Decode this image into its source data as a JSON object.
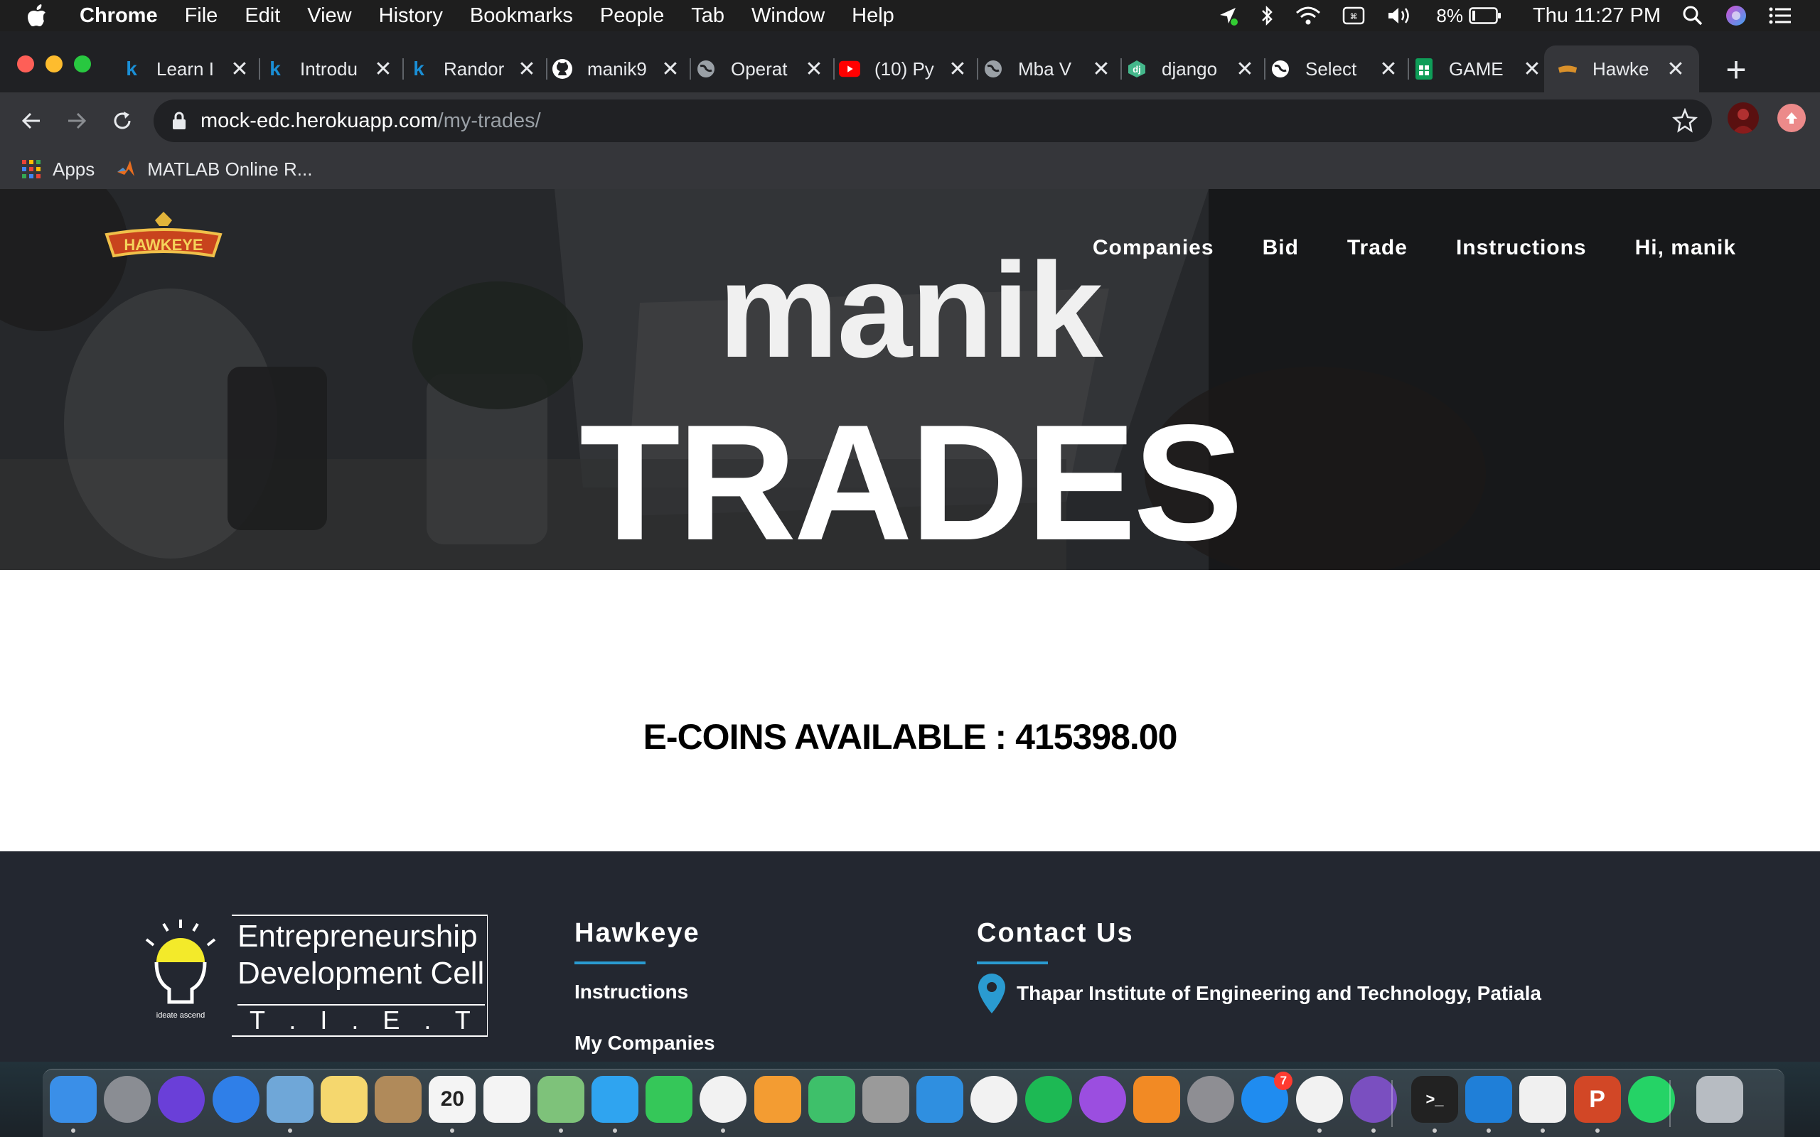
{
  "menubar": {
    "app_name": "Chrome",
    "items": [
      "File",
      "Edit",
      "View",
      "History",
      "Bookmarks",
      "People",
      "Tab",
      "Window",
      "Help"
    ],
    "battery": "8%",
    "clock": "Thu 11:27 PM"
  },
  "tabs": [
    {
      "label": "Learn I",
      "icon": "k-icon",
      "color": "#1a8fd6"
    },
    {
      "label": "Introdu",
      "icon": "k-icon",
      "color": "#1a8fd6"
    },
    {
      "label": "Randor",
      "icon": "k-icon",
      "color": "#1a8fd6"
    },
    {
      "label": "manik9",
      "icon": "github-icon",
      "color": "#ffffff"
    },
    {
      "label": "Operat",
      "icon": "globe-icon",
      "color": "#9aa0a6"
    },
    {
      "label": "(10) Py",
      "icon": "youtube-icon",
      "color": "#ff0000"
    },
    {
      "label": "Mba V",
      "icon": "globe-icon",
      "color": "#9aa0a6"
    },
    {
      "label": "django",
      "icon": "django-icon",
      "color": "#44b78b"
    },
    {
      "label": "Select",
      "icon": "globe-icon",
      "color": "#ffffff"
    },
    {
      "label": "GAME",
      "icon": "sheets-icon",
      "color": "#0f9d58"
    },
    {
      "label": "Hawke",
      "icon": "hawkeye-icon",
      "color": "#d9902a",
      "active": true
    }
  ],
  "address": {
    "host": "mock-edc.herokuapp.com",
    "path": "/my-trades/"
  },
  "bookmarks": [
    {
      "label": "Apps",
      "icon": "apps-grid-icon"
    },
    {
      "label": "MATLAB Online R...",
      "icon": "matlab-icon"
    }
  ],
  "site": {
    "logo_text": "HAWKEYE",
    "nav": [
      "Companies",
      "Bid",
      "Trade",
      "Instructions",
      "Hi, manik"
    ],
    "hero_name": "manik",
    "hero_title": "TRADES",
    "coins_label": "E-COINS AVAILABLE : 415398.00"
  },
  "footer": {
    "edc_line1": "Entrepreneurship",
    "edc_line2": "Development Cell",
    "edc_line3": "T . I . E . T .",
    "edc_bulb_text": "ideate ascend",
    "col1_title": "Hawkeye",
    "col1_links": [
      "Instructions",
      "My Companies"
    ],
    "col2_title": "Contact Us",
    "address": "Thapar Institute of Engineering and Technology, Patiala"
  },
  "dock": [
    {
      "name": "finder-icon",
      "color": "#3a8fe8",
      "label": ""
    },
    {
      "name": "launchpad-icon",
      "color": "#8a8d93",
      "label": ""
    },
    {
      "name": "siri-icon",
      "color": "#6a3fd8",
      "label": ""
    },
    {
      "name": "safari-icon",
      "color": "#2f7fe8",
      "label": ""
    },
    {
      "name": "mail-hawk-icon",
      "color": "#6fa7d8",
      "label": ""
    },
    {
      "name": "notes-icon",
      "color": "#f5d76e",
      "label": ""
    },
    {
      "name": "contacts-icon",
      "color": "#b08a5a",
      "label": ""
    },
    {
      "name": "calendar-icon",
      "color": "#f4f4f4",
      "label": "20"
    },
    {
      "name": "reminders-icon",
      "color": "#f4f4f4",
      "label": ""
    },
    {
      "name": "maps-icon",
      "color": "#7ec27a",
      "label": ""
    },
    {
      "name": "messages-icon",
      "color": "#2fa4f0",
      "label": ""
    },
    {
      "name": "facetime-icon",
      "color": "#35c759",
      "label": ""
    },
    {
      "name": "photos-icon",
      "color": "#f2f2f2",
      "label": ""
    },
    {
      "name": "pages-icon",
      "color": "#f39c32",
      "label": ""
    },
    {
      "name": "numbers-icon",
      "color": "#3ec06a",
      "label": ""
    },
    {
      "name": "calculator-icon",
      "color": "#9a9a9a",
      "label": ""
    },
    {
      "name": "keynote-icon",
      "color": "#2f8fe0",
      "label": ""
    },
    {
      "name": "music-icon",
      "color": "#f2f2f2",
      "label": ""
    },
    {
      "name": "spotify-icon",
      "color": "#1db954",
      "label": ""
    },
    {
      "name": "podcasts-icon",
      "color": "#9b4ee0",
      "label": ""
    },
    {
      "name": "books-icon",
      "color": "#f28a24",
      "label": ""
    },
    {
      "name": "system-preferences-icon",
      "color": "#8e8e93",
      "label": ""
    },
    {
      "name": "app-store-icon",
      "color": "#1f8cf0",
      "label": "",
      "badge": "7"
    },
    {
      "name": "chrome-icon",
      "color": "#f2f2f2",
      "label": ""
    },
    {
      "name": "github-desktop-icon",
      "color": "#7a4fc0",
      "label": ""
    },
    {
      "name": "terminal-icon",
      "color": "#222222",
      "label": ">_"
    },
    {
      "name": "vscode-icon",
      "color": "#1f7fd8",
      "label": ""
    },
    {
      "name": "textedit-icon",
      "color": "#f0f0f0",
      "label": ""
    },
    {
      "name": "powerpoint-icon",
      "color": "#d24726",
      "label": "P"
    },
    {
      "name": "whatsapp-icon",
      "color": "#25d366",
      "label": ""
    },
    {
      "name": "trash-icon",
      "color": "#b7bcc2",
      "label": ""
    }
  ]
}
